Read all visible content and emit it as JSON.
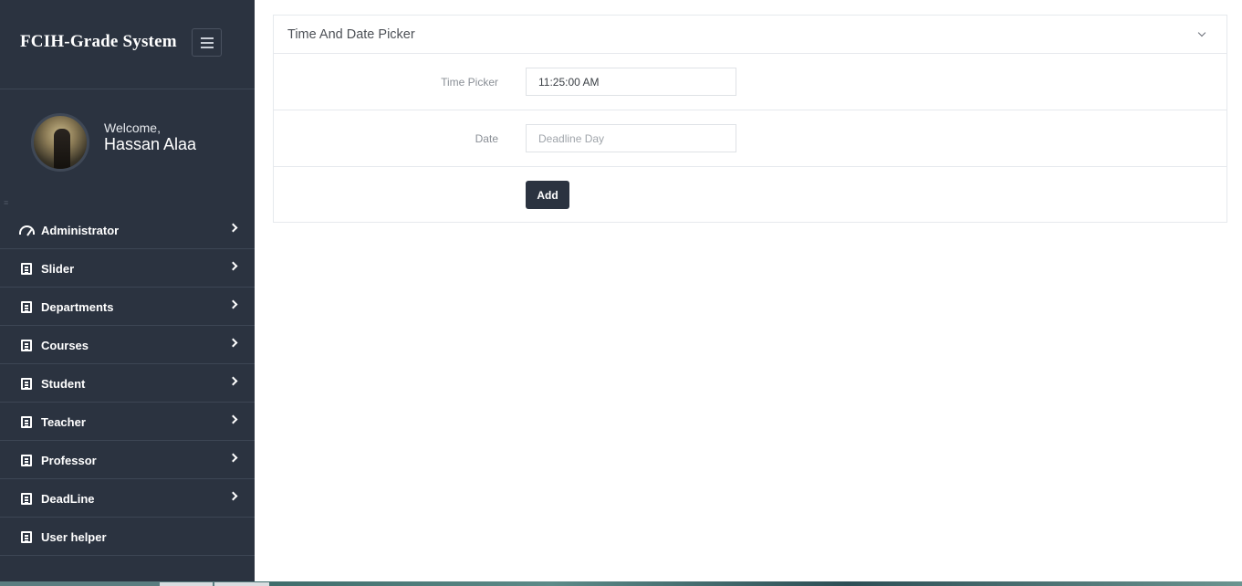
{
  "brand": {
    "title": "FCIH-Grade System"
  },
  "profile": {
    "welcome": "Welcome,",
    "name": "Hassan Alaa"
  },
  "sidebar": {
    "items": [
      {
        "label": "Administrator",
        "icon": "dashboard-gauge-icon",
        "has_chevron": true
      },
      {
        "label": "Slider",
        "icon": "document-icon",
        "has_chevron": true
      },
      {
        "label": "Departments",
        "icon": "document-icon",
        "has_chevron": true
      },
      {
        "label": "Courses",
        "icon": "document-icon",
        "has_chevron": true
      },
      {
        "label": "Student",
        "icon": "document-icon",
        "has_chevron": true
      },
      {
        "label": "Teacher",
        "icon": "document-icon",
        "has_chevron": true
      },
      {
        "label": "Professor",
        "icon": "document-icon",
        "has_chevron": true
      },
      {
        "label": "DeadLine",
        "icon": "document-icon",
        "has_chevron": true
      },
      {
        "label": "User helper",
        "icon": "document-icon",
        "has_chevron": false
      }
    ]
  },
  "panel": {
    "title": "Time And Date Picker",
    "time_label": "Time Picker",
    "time_value": "11:25:00 AM",
    "date_label": "Date",
    "date_placeholder": "Deadline Day",
    "add_label": "Add"
  },
  "colors": {
    "sidebar_bg": "#2b3340",
    "button_bg": "#2b3340",
    "text_white": "#ffffff"
  }
}
